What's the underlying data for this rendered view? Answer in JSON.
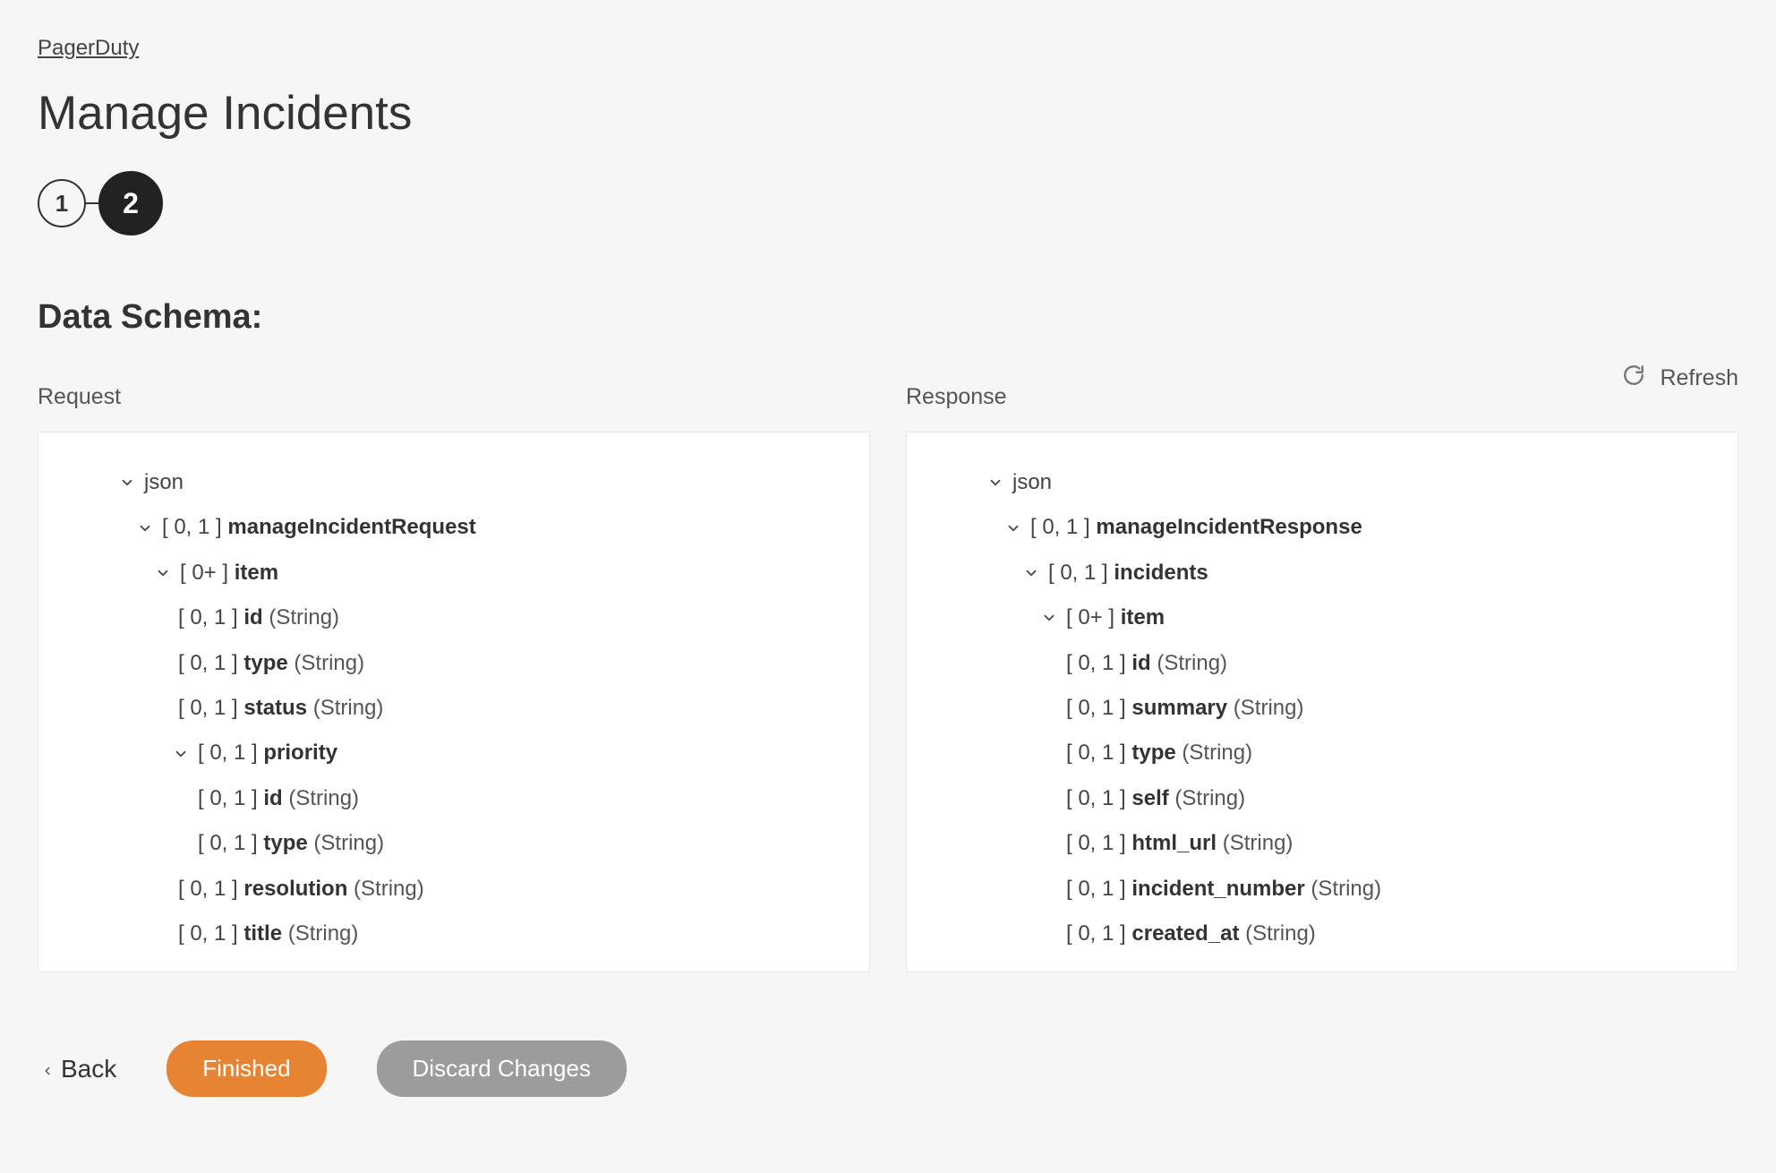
{
  "breadcrumb": "PagerDuty",
  "page_title": "Manage Incidents",
  "stepper": {
    "step1": "1",
    "step2": "2"
  },
  "section_title": "Data Schema:",
  "refresh_label": "Refresh",
  "request_label": "Request",
  "response_label": "Response",
  "footer": {
    "back": "Back",
    "finished": "Finished",
    "discard": "Discard Changes"
  },
  "req": {
    "json": "json",
    "root_card": "[ 0, 1 ] ",
    "root_name": "manageIncidentRequest",
    "item_card": "[ 0+ ] ",
    "item_name": "item",
    "id_card": "[ 0, 1 ] ",
    "id_name": "id",
    "id_type": " (String)",
    "type_card": "[ 0, 1 ] ",
    "type_name": "type",
    "type_type": " (String)",
    "status_card": "[ 0, 1 ] ",
    "status_name": "status",
    "status_type": " (String)",
    "priority_card": "[ 0, 1 ] ",
    "priority_name": "priority",
    "p_id_card": "[ 0, 1 ] ",
    "p_id_name": "id",
    "p_id_type": " (String)",
    "p_type_card": "[ 0, 1 ] ",
    "p_type_name": "type",
    "p_type_type": " (String)",
    "resolution_card": "[ 0, 1 ] ",
    "resolution_name": "resolution",
    "resolution_type": " (String)",
    "title_card": "[ 0, 1 ] ",
    "title_name": "title",
    "title_type": " (String)"
  },
  "res": {
    "json": "json",
    "root_card": "[ 0, 1 ] ",
    "root_name": "manageIncidentResponse",
    "incidents_card": "[ 0, 1 ] ",
    "incidents_name": "incidents",
    "item_card": "[ 0+ ] ",
    "item_name": "item",
    "id_card": "[ 0, 1 ] ",
    "id_name": "id",
    "id_type": " (String)",
    "summary_card": "[ 0, 1 ] ",
    "summary_name": "summary",
    "summary_type": " (String)",
    "type_card": "[ 0, 1 ] ",
    "type_name": "type",
    "type_type": " (String)",
    "self_card": "[ 0, 1 ] ",
    "self_name": "self",
    "self_type": " (String)",
    "html_card": "[ 0, 1 ] ",
    "html_name": "html_url",
    "html_type": " (String)",
    "num_card": "[ 0, 1 ] ",
    "num_name": "incident_number",
    "num_type": " (String)",
    "created_card": "[ 0, 1 ] ",
    "created_name": "created_at",
    "created_type": " (String)"
  }
}
